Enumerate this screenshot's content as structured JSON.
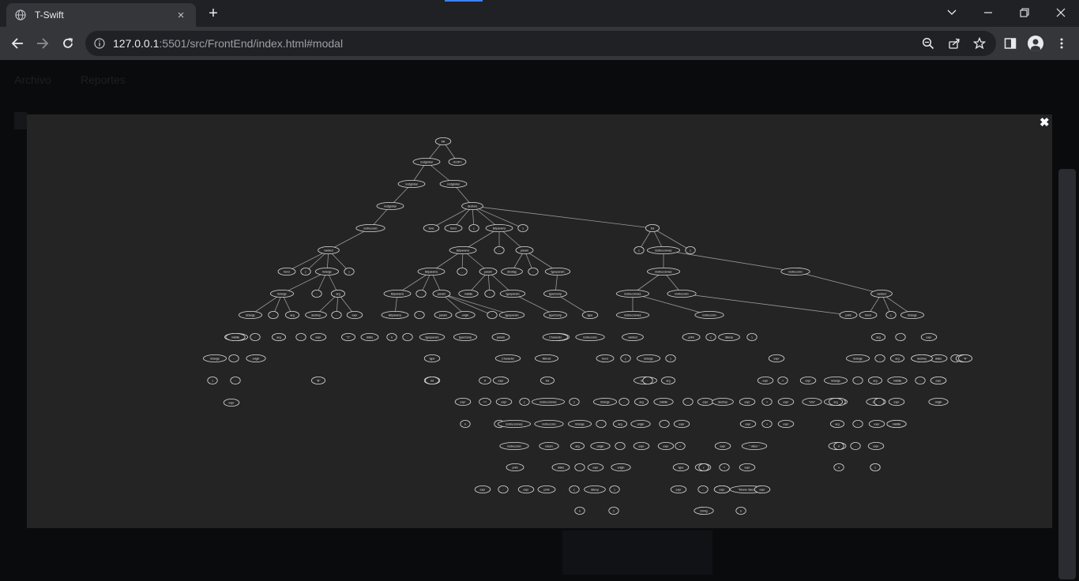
{
  "browser": {
    "tab_title": "T-Swift",
    "tab_close": "×",
    "new_tab": "+",
    "url_host": "127.0.0.1",
    "url_rest": ":5501/src/FrontEnd/index.html#modal"
  },
  "page": {
    "nav": [
      "Archivo",
      "Reportes"
    ]
  },
  "modal": {
    "close": "✖",
    "tree": {
      "nodes": [
        [
          "n0",
          "init"
        ],
        [
          "n1",
          "instglobal"
        ],
        [
          "n2",
          "<EOF>"
        ],
        [
          "n3",
          "instglobal"
        ],
        [
          "n4",
          "instglobal"
        ],
        [
          "n5",
          "instglobal"
        ],
        [
          "n6",
          "decfunc"
        ],
        [
          "n7",
          "instruccion"
        ],
        [
          "n8",
          "func"
        ],
        [
          "n9",
          "funcl"
        ],
        [
          "n10",
          "("
        ],
        [
          "n11",
          "listparams"
        ],
        [
          "n12",
          ")"
        ],
        [
          "n13",
          "ins"
        ],
        [
          "n14",
          "vardecl"
        ],
        [
          "n15",
          "listparams"
        ],
        [
          "n16",
          ","
        ],
        [
          "n17",
          "param"
        ],
        [
          "n18",
          "{"
        ],
        [
          "n19",
          "instrucciones"
        ],
        [
          "n20",
          "}"
        ],
        [
          "n21",
          "funcl"
        ],
        [
          "n22",
          "("
        ],
        [
          "n23",
          "listargs"
        ],
        [
          "n24",
          ")"
        ],
        [
          "n25",
          "listparams"
        ],
        [
          "n26",
          ","
        ],
        [
          "n27",
          "param"
        ],
        [
          "n28",
          "divdiag"
        ],
        [
          "n29",
          "-"
        ],
        [
          "n30",
          "typeparam"
        ],
        [
          "n31",
          "instrucciones"
        ],
        [
          "n32",
          "instruccion"
        ],
        [
          "n33",
          "listargs"
        ],
        [
          "n34",
          "-"
        ],
        [
          "n35",
          "arg"
        ],
        [
          "n36",
          "listparams"
        ],
        [
          "n37",
          "-"
        ],
        [
          "n38",
          "param"
        ],
        [
          "n39",
          "middle"
        ],
        [
          "n40",
          "-"
        ],
        [
          "n41",
          "typeparam"
        ],
        [
          "n42",
          "typeComp"
        ],
        [
          "n43",
          "instrucciones"
        ],
        [
          "n44",
          "instruccion"
        ],
        [
          "n45",
          "vardecl"
        ],
        [
          "n46",
          "listargs"
        ],
        [
          "n47",
          "-"
        ],
        [
          "n48",
          "arg"
        ],
        [
          "n49",
          "destroy"
        ],
        [
          "n50",
          "-"
        ],
        [
          "n51",
          "expr"
        ],
        [
          "n52",
          "listparams"
        ],
        [
          "n53",
          "-"
        ],
        [
          "n54",
          "param"
        ],
        [
          "n55",
          "origin"
        ],
        [
          "n56",
          "-"
        ],
        [
          "n57",
          "typeparam"
        ],
        [
          "n58",
          "typeComp"
        ],
        [
          "n59",
          "type"
        ],
        [
          "n60",
          "instrucciones"
        ],
        [
          "n61",
          "instruccion"
        ],
        [
          "n62",
          "print"
        ],
        [
          "n63",
          "funcl"
        ],
        [
          "n64",
          "("
        ],
        [
          "n65",
          "listargs"
        ],
        [
          "n66",
          ")"
        ],
        [
          "n67",
          "listargs"
        ],
        [
          "n68",
          "-"
        ],
        [
          "n69",
          "arg"
        ],
        [
          "n70",
          "middle"
        ],
        [
          "n71",
          "-"
        ],
        [
          "n72",
          "expr"
        ],
        [
          "n73",
          "\"C\""
        ],
        [
          "n74",
          "param"
        ],
        [
          "n75",
          "typeComp"
        ],
        [
          "n76",
          "type"
        ],
        [
          "n77",
          "Character"
        ],
        [
          "n78",
          "instruccion"
        ],
        [
          "n79",
          "vardecl"
        ],
        [
          "n80",
          "print"
        ],
        [
          "n81",
          "("
        ],
        [
          "n82",
          "listexp"
        ],
        [
          "n83",
          ")"
        ],
        [
          "n84",
          "listargs"
        ],
        [
          "n85",
          "-"
        ],
        [
          "n86",
          "arg"
        ],
        [
          "n87",
          "origin"
        ],
        [
          "n88",
          "-"
        ],
        [
          "n89",
          "expr"
        ],
        [
          "n90",
          "\"B\""
        ],
        [
          "n91",
          "disks"
        ],
        [
          "n92",
          "n"
        ],
        [
          "n93",
          ":"
        ],
        [
          "n94",
          "typeparam"
        ],
        [
          "n95",
          "type"
        ],
        [
          "n96",
          "Character"
        ],
        [
          "n97",
          "ifstruct"
        ],
        [
          "n98",
          "funcl"
        ],
        [
          "n99",
          "("
        ],
        [
          "n100",
          "listargs"
        ],
        [
          "n101",
          ")"
        ],
        [
          "n102",
          "expr"
        ],
        [
          "n103",
          "arg"
        ],
        [
          "n104",
          "-"
        ],
        [
          "n105",
          "expr"
        ],
        [
          "n106",
          "typeComp"
        ],
        [
          "n107",
          "if"
        ],
        [
          "n108",
          "expr"
        ],
        [
          "n109",
          "ins"
        ],
        [
          "n110",
          "listargs"
        ],
        [
          "n111",
          "-"
        ],
        [
          "n112",
          "arg"
        ],
        [
          "n113",
          "expr"
        ],
        [
          "n114",
          "+"
        ],
        [
          "n115",
          "expr"
        ],
        [
          "n116",
          "listargs"
        ],
        [
          "n117",
          "-"
        ],
        [
          "n118",
          "arg"
        ],
        [
          "n119",
          "-"
        ],
        [
          "n120",
          "arg"
        ],
        [
          "n121",
          "destroy"
        ],
        [
          "n122",
          "disks"
        ],
        [
          "n123",
          "-"
        ],
        [
          "n124",
          "expr"
        ],
        [
          "n125",
          "\"A\""
        ],
        [
          "n126",
          "type"
        ],
        [
          "n127",
          "expr"
        ],
        [
          "n128",
          "=="
        ],
        [
          "n129",
          "expr"
        ],
        [
          "n130",
          "{"
        ],
        [
          "n131",
          "instrucciones"
        ],
        [
          "n132",
          "}"
        ],
        [
          "n133",
          "listargs"
        ],
        [
          "n134",
          "-"
        ],
        [
          "n135",
          "arg"
        ],
        [
          "n136",
          "middle"
        ],
        [
          "n137",
          "-"
        ],
        [
          "n138",
          "expr"
        ],
        [
          "n139",
          "expr"
        ],
        [
          "n140",
          "+"
        ],
        [
          "n141",
          "expr"
        ],
        [
          "n142",
          "\"\\nlo\""
        ],
        [
          "n143",
          "listargs"
        ],
        [
          "n144",
          "-"
        ],
        [
          "n145",
          "arg"
        ],
        [
          "n146",
          "middle"
        ],
        [
          "n147",
          "-"
        ],
        [
          "n148",
          "expr"
        ],
        [
          "n149",
          "destroy"
        ],
        [
          "n150",
          "expr"
        ],
        [
          "n151",
          "Int"
        ],
        [
          "n152",
          "n"
        ],
        [
          "n153",
          "1"
        ],
        [
          "n154",
          "instrucciones"
        ],
        [
          "n155",
          "instruccion"
        ],
        [
          "n156",
          "listargs"
        ],
        [
          "n157",
          "-"
        ],
        [
          "n158",
          "arg"
        ],
        [
          "n159",
          "origin"
        ],
        [
          "n160",
          "-"
        ],
        [
          "n161",
          "expr"
        ],
        [
          "n162",
          "destroy"
        ],
        [
          "n163",
          "expr"
        ],
        [
          "n164",
          "+"
        ],
        [
          "n165",
          "expr"
        ],
        [
          "n166",
          "listargs"
        ],
        [
          "n167",
          "-"
        ],
        [
          "n168",
          "arg"
        ],
        [
          "n169",
          "origin"
        ],
        [
          "n170",
          "-"
        ],
        [
          "n171",
          "expr"
        ],
        [
          "n172",
          "middle"
        ],
        [
          "n173",
          "origin"
        ],
        [
          "n174",
          "instruccion"
        ],
        [
          "n175",
          "return"
        ],
        [
          "n176",
          "arg"
        ],
        [
          "n177",
          "origin"
        ],
        [
          "n178",
          "-"
        ],
        [
          "n179",
          "expr"
        ],
        [
          "n180",
          "expr"
        ],
        [
          "n181",
          "+"
        ],
        [
          "n182",
          "expr"
        ],
        [
          "n183",
          "\" disco \""
        ],
        [
          "n184",
          "arg"
        ],
        [
          "n185",
          "-"
        ],
        [
          "n186",
          "expr"
        ],
        [
          "n187",
          "middle"
        ],
        [
          "n188",
          "print"
        ],
        [
          "n189",
          "disks"
        ],
        [
          "n190",
          "-"
        ],
        [
          "n191",
          "expr"
        ],
        [
          "n192",
          "origin"
        ],
        [
          "n193",
          "expr"
        ],
        [
          "n194",
          "+"
        ],
        [
          "n195",
          "expr"
        ],
        [
          "n196",
          "disks"
        ],
        [
          "n197",
          "-"
        ],
        [
          "n198",
          "expr"
        ],
        [
          "n199",
          "expr"
        ],
        [
          "n200",
          "-"
        ],
        [
          "n201",
          "expr"
        ],
        [
          "n202",
          "print"
        ],
        [
          "n203",
          "("
        ],
        [
          "n204",
          "listexp"
        ],
        [
          "n205",
          ")"
        ],
        [
          "n206",
          "expr"
        ],
        [
          "n207",
          "-"
        ],
        [
          "n208",
          "expr"
        ],
        [
          "n209",
          "\"Mover disco \""
        ],
        [
          "n210",
          "type"
        ],
        [
          "n211",
          "("
        ],
        [
          "n212",
          "expr"
        ],
        [
          "n213",
          ")"
        ],
        [
          "n214",
          "n"
        ],
        [
          "n215",
          "1"
        ],
        [
          "n216",
          "expr"
        ],
        [
          "n217",
          "n"
        ],
        [
          "n218",
          "1"
        ],
        [
          "n219",
          "String"
        ],
        [
          "n220",
          "n"
        ],
        [
          "n221",
          "n"
        ],
        [
          "n222",
          "1"
        ]
      ]
    }
  }
}
